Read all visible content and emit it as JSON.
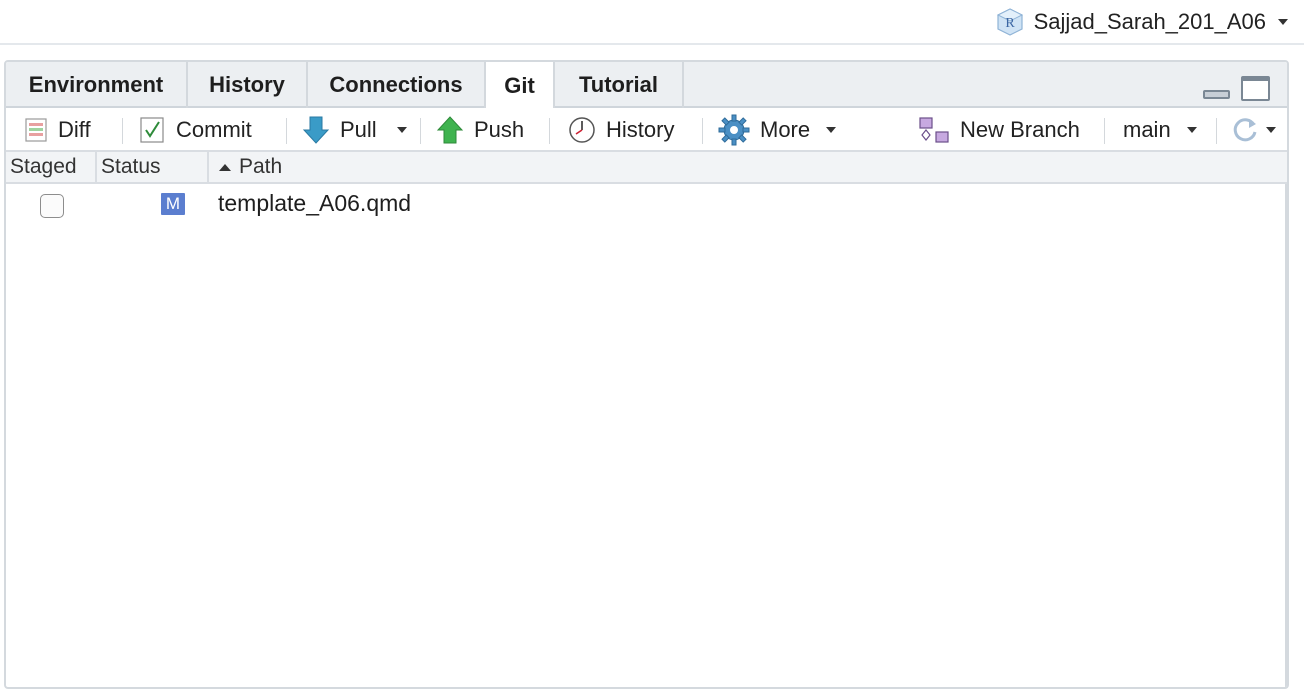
{
  "project": {
    "name": "Sajjad_Sarah_201_A06",
    "icon": "r-project-icon"
  },
  "tabs": [
    {
      "label": "Environment",
      "active": false
    },
    {
      "label": "History",
      "active": false
    },
    {
      "label": "Connections",
      "active": false
    },
    {
      "label": "Git",
      "active": true
    },
    {
      "label": "Tutorial",
      "active": false
    }
  ],
  "toolbar": {
    "diff_label": "Diff",
    "commit_label": "Commit",
    "pull_label": "Pull",
    "push_label": "Push",
    "history_label": "History",
    "more_label": "More",
    "new_branch_label": "New Branch",
    "branch_label": "main"
  },
  "columns": {
    "staged": "Staged",
    "status": "Status",
    "path": "Path"
  },
  "files": [
    {
      "staged": false,
      "status": "M",
      "path": "template_A06.qmd"
    }
  ],
  "colors": {
    "status_modified": "#5b7ecf",
    "pull_arrow": "#3a9bc7",
    "push_arrow": "#3fb34f"
  }
}
